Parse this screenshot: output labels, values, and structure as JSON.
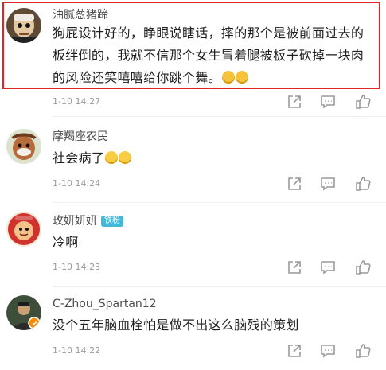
{
  "comments": [
    {
      "username": "油腻葱猪蹄",
      "text": "狗屁设计好的，睁眼说瞎话，摔的那个是被前面过去的板绊倒的，我就不信那个女生冒着腿被板子砍掉一块肉的风险还笑嘻嘻给你跳个舞。",
      "emojis": [
        "smug-face-emoji",
        "smug-face-emoji"
      ],
      "time": "1-10 14:27",
      "highlighted": true
    },
    {
      "username": "摩羯座农民",
      "text": "社会病了",
      "emojis": [
        "crying-face-emoji",
        "crying-face-emoji"
      ],
      "time": "1-10 14:24"
    },
    {
      "username": "玫妍妍妍",
      "badge": "铁粉",
      "text": "冷啊",
      "time": "1-10 14:23"
    },
    {
      "username": "C-Zhou_Spartan12",
      "text": "没个五年脑血栓怕是做不出这么脑残的策划",
      "time": "1-10 14:22"
    }
  ],
  "actions": {
    "icons": [
      "share-icon",
      "reply-icon",
      "like-icon"
    ]
  },
  "colors": {
    "highlight": "#e02424",
    "badge": "#41b8d8",
    "meta": "#9a9a9a"
  }
}
